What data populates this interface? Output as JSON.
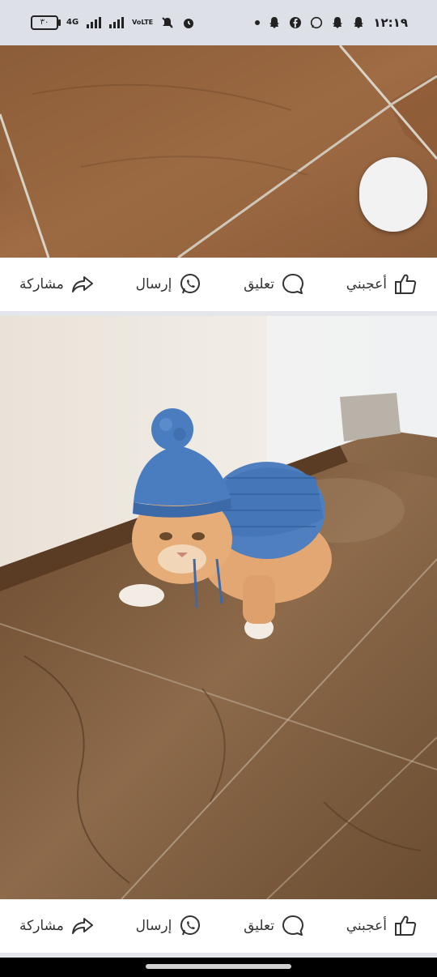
{
  "status_bar": {
    "battery": "٣٠",
    "network": "4G",
    "volte": "VoLTE",
    "time": "١٢:١٩",
    "icons": [
      "battery-icon",
      "signal-icon",
      "signal-icon",
      "volte-icon",
      "mute-icon",
      "alarm-icon",
      "dot-icon",
      "snapchat-icon",
      "facebook-icon",
      "whatsapp-icon",
      "snapchat-icon",
      "snapchat-icon"
    ]
  },
  "posts": [
    {
      "image": "wood-floor-photo",
      "actions": {
        "share": "مشاركة",
        "send": "إرسال",
        "comment": "تعليق",
        "like": "أعجبني"
      }
    },
    {
      "image": "cat-in-knitted-sweater-photo",
      "actions": {
        "share": "مشاركة",
        "send": "إرسال",
        "comment": "تعليق",
        "like": "أعجبني"
      }
    }
  ],
  "colors": {
    "status_bar_bg": "#dde0e6",
    "divider": "#e4e6eb",
    "text": "#333333"
  }
}
